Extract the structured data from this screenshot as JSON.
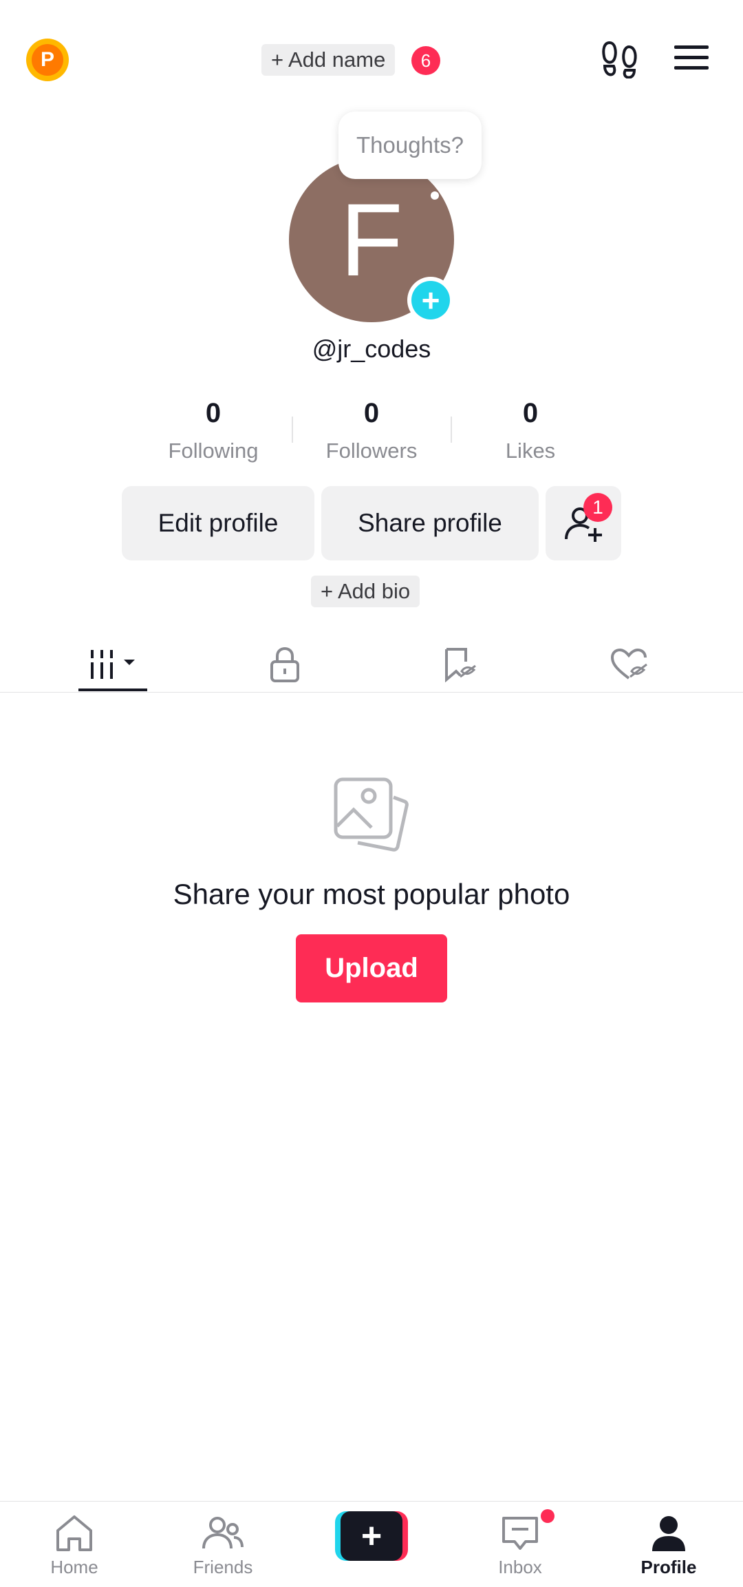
{
  "header": {
    "coin_letter": "P",
    "add_name_label": "+ Add name",
    "notification_count": "6",
    "icons": [
      "footprint-icon",
      "menu-icon"
    ]
  },
  "profile": {
    "avatar_letter": "F",
    "thought_bubble": "Thoughts?",
    "username": "@jr_codes",
    "stats": [
      {
        "value": "0",
        "label": "Following"
      },
      {
        "value": "0",
        "label": "Followers"
      },
      {
        "value": "0",
        "label": "Likes"
      }
    ],
    "edit_profile_label": "Edit profile",
    "share_profile_label": "Share profile",
    "friend_request_badge": "1",
    "add_bio_label": "+ Add bio"
  },
  "tabs": [
    {
      "icon": "grid-icon",
      "active": true
    },
    {
      "icon": "lock-icon",
      "active": false
    },
    {
      "icon": "bookmark-hidden-icon",
      "active": false
    },
    {
      "icon": "heart-hidden-icon",
      "active": false
    }
  ],
  "empty_state": {
    "icon": "photo-icon",
    "message": "Share your most popular photo",
    "upload_label": "Upload"
  },
  "bottom_nav": {
    "items": [
      {
        "label": "Home",
        "icon": "home-icon"
      },
      {
        "label": "Friends",
        "icon": "friends-icon"
      },
      {
        "label": "",
        "icon": "create-plus-icon"
      },
      {
        "label": "Inbox",
        "icon": "inbox-icon"
      },
      {
        "label": "Profile",
        "icon": "profile-icon",
        "active": true
      }
    ],
    "create_symbol": "+"
  },
  "colors": {
    "accent": "#fe2c55",
    "cyan": "#20d5ec",
    "avatar": "#8d6e63",
    "coin": "#ffb800"
  }
}
